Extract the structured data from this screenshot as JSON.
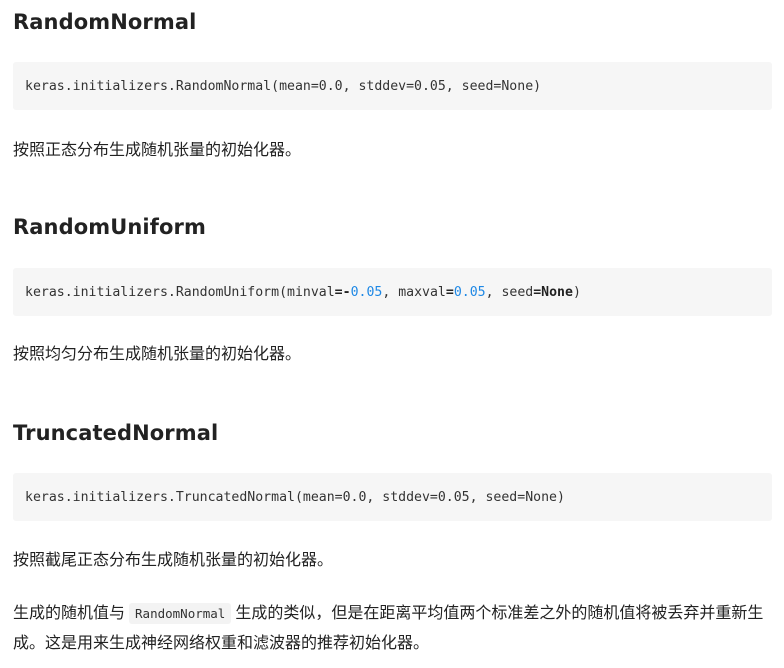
{
  "sections": [
    {
      "title": "RandomNormal",
      "code": "keras.initializers.RandomNormal(mean=0.0, stddev=0.05, seed=None)",
      "description": "按照正态分布生成随机张量的初始化器。"
    },
    {
      "title": "RandomUniform",
      "code_parts": {
        "prefix": "keras.initializers.RandomUniform(minval",
        "eq1": "=",
        "neg": "-",
        "min_value": "0.05",
        "mid": ", maxval",
        "eq2": "=",
        "max_value": "0.05",
        "seed_label": ", seed",
        "eq3": "=",
        "seed_value": "None",
        "close": ")"
      },
      "description": "按照均匀分布生成随机张量的初始化器。"
    },
    {
      "title": "TruncatedNormal",
      "code": "keras.initializers.TruncatedNormal(mean=0.0, stddev=0.05, seed=None)",
      "description": "按照截尾正态分布生成随机张量的初始化器。",
      "note": {
        "before": "生成的随机值与",
        "code": "RandomNormal",
        "after": "生成的类似，但是在距离平均值两个标准差之外的随机值将被丢弃并重新生成。这是用来生成神经网络权重和滤波器的推荐初始化器。"
      }
    }
  ],
  "colors": {
    "code_background": "#f6f6f6",
    "number": "#1e88e5",
    "text": "#222222"
  }
}
